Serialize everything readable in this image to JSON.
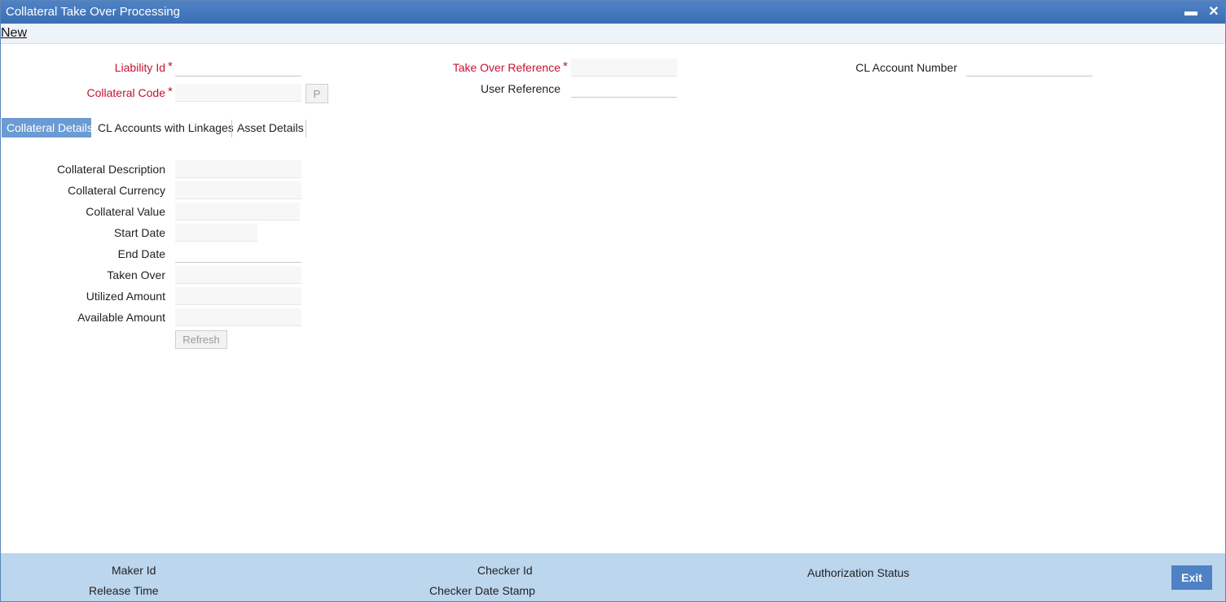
{
  "window": {
    "title": "Collateral Take Over Processing",
    "minimize_symbol": "▬",
    "close_symbol": "✕"
  },
  "menu": {
    "new_label": "New"
  },
  "header": {
    "liability_id": {
      "label": "Liability Id",
      "required_mark": "*",
      "value": ""
    },
    "collateral_code": {
      "label": "Collateral Code",
      "required_mark": "*",
      "value": "",
      "lookup_label": "P"
    },
    "take_over_reference": {
      "label": "Take Over Reference",
      "required_mark": "*",
      "value": ""
    },
    "user_reference": {
      "label": "User Reference",
      "value": ""
    },
    "cl_account_number": {
      "label": "CL Account Number",
      "value": ""
    }
  },
  "tabs": [
    {
      "label": "Collateral Details",
      "active": true
    },
    {
      "label": "CL Accounts with Linkages",
      "active": false
    },
    {
      "label": "Asset Details",
      "active": false
    }
  ],
  "collateral_details": {
    "fields": [
      {
        "label": "Collateral Description",
        "value": ""
      },
      {
        "label": "Collateral Currency",
        "value": ""
      },
      {
        "label": "Collateral Value",
        "value": ""
      },
      {
        "label": "Start Date",
        "value": ""
      },
      {
        "label": "End Date",
        "value": ""
      },
      {
        "label": "Taken Over",
        "value": ""
      },
      {
        "label": "Utilized Amount",
        "value": ""
      },
      {
        "label": "Available Amount",
        "value": ""
      }
    ],
    "refresh_label": "Refresh"
  },
  "footer": {
    "maker_id": "Maker Id",
    "release_time": "Release Time",
    "checker_id": "Checker Id",
    "checker_date_stamp": "Checker Date Stamp",
    "authorization_status": "Authorization Status",
    "exit_label": "Exit"
  },
  "colors": {
    "title_bar": "#3a6fb5",
    "required_label": "#c8102e",
    "active_tab": "#6b9bd2",
    "footer_bg": "#bcd6ee",
    "exit_button": "#4f82c4"
  }
}
